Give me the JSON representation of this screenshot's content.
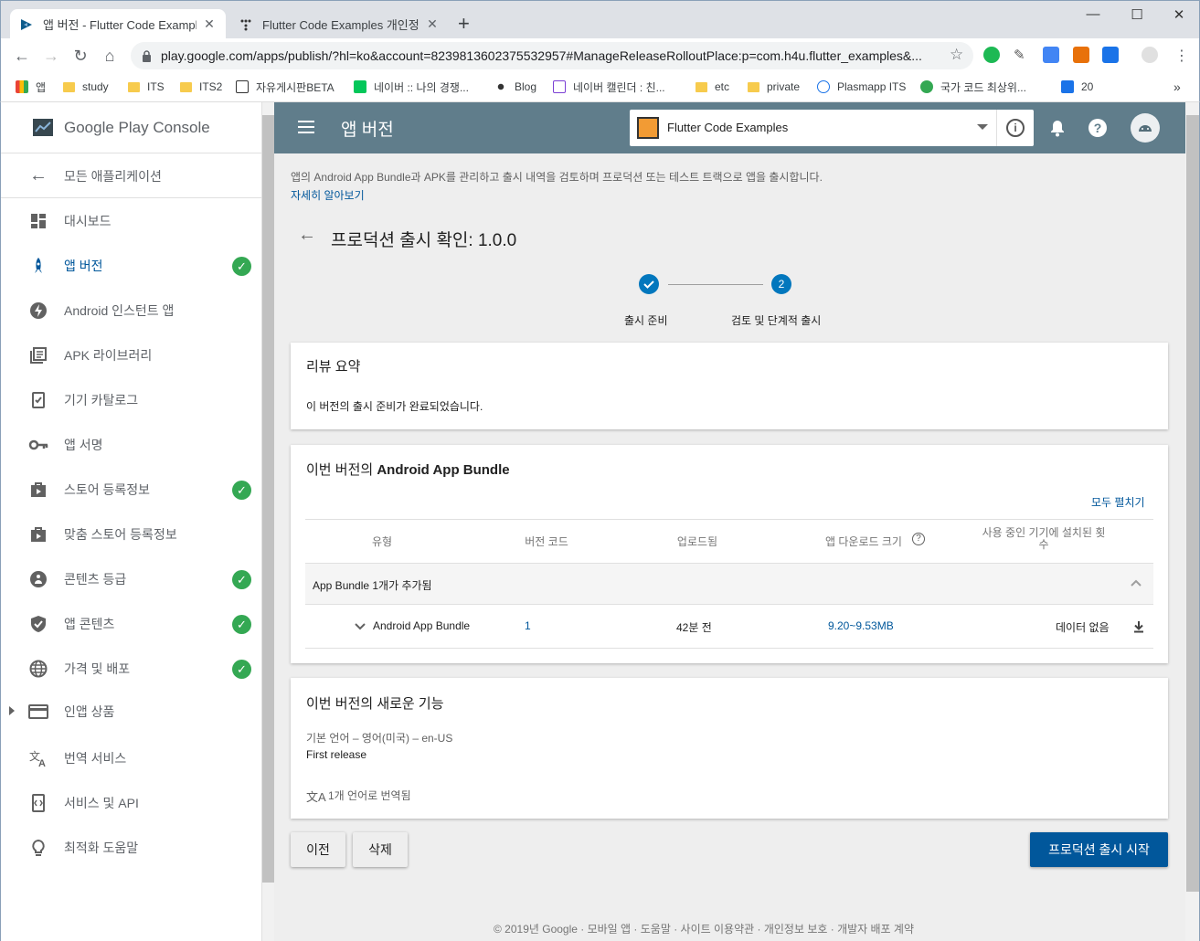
{
  "browser": {
    "tabs": [
      {
        "title": "앱 버전 - Flutter Code Examples",
        "active": true
      },
      {
        "title": "Flutter Code Examples 개인정보",
        "active": false
      }
    ],
    "new_tab": "+",
    "window_controls": {
      "minimize": "—",
      "maximize": "☐",
      "close": "✕"
    },
    "url": "play.google.com/apps/publish/?hl=ko&account=8239813602375532957#ManageReleaseRolloutPlace:p=com.h4u.flutter_examples&...",
    "bookmarks": [
      {
        "label": "앱",
        "icon": "apps-grid-icon"
      },
      {
        "label": "study",
        "icon": "folder-icon"
      },
      {
        "label": "ITS",
        "icon": "folder-icon"
      },
      {
        "label": "ITS2",
        "icon": "folder-icon"
      },
      {
        "label": "자유게시판BETA",
        "icon": "site-icon"
      },
      {
        "label": "네이버 :: 나의 경쟁...",
        "icon": "naver-icon"
      },
      {
        "label": "Blog",
        "icon": "site-icon"
      },
      {
        "label": "네이버 캘린더 : 친...",
        "icon": "calendar-icon"
      },
      {
        "label": "etc",
        "icon": "folder-icon"
      },
      {
        "label": "private",
        "icon": "folder-icon"
      },
      {
        "label": "Plasmapp ITS",
        "icon": "site-icon"
      },
      {
        "label": "국가 코드 최상위...",
        "icon": "site-icon"
      },
      {
        "label": "20",
        "icon": "site-icon"
      }
    ],
    "bookmarks_more": "»"
  },
  "console": {
    "logo_text": "Google Play Console",
    "back_label": "모든 애플리케이션",
    "nav": [
      {
        "label": "대시보드",
        "icon": "dashboard-icon",
        "check": false,
        "active": false
      },
      {
        "label": "앱 버전",
        "icon": "rocket-icon",
        "check": true,
        "active": true
      },
      {
        "label": "Android 인스턴트 앱",
        "icon": "bolt-icon",
        "check": false,
        "active": false
      },
      {
        "label": "APK 라이브러리",
        "icon": "library-icon",
        "check": false,
        "active": false
      },
      {
        "label": "기기 카탈로그",
        "icon": "device-catalog-icon",
        "check": false,
        "active": false
      },
      {
        "label": "앱 서명",
        "icon": "key-icon",
        "check": false,
        "active": false
      },
      {
        "label": "스토어 등록정보",
        "icon": "store-icon",
        "check": true,
        "active": false
      },
      {
        "label": "맞춤 스토어 등록정보",
        "icon": "custom-store-icon",
        "check": false,
        "active": false
      },
      {
        "label": "콘텐츠 등급",
        "icon": "content-rating-icon",
        "check": true,
        "active": false
      },
      {
        "label": "앱 콘텐츠",
        "icon": "shield-icon",
        "check": true,
        "active": false
      },
      {
        "label": "가격 및 배포",
        "icon": "globe-icon",
        "check": true,
        "active": false
      },
      {
        "label": "인앱 상품",
        "icon": "card-icon",
        "check": false,
        "active": false
      },
      {
        "label": "번역 서비스",
        "icon": "translate-icon",
        "check": false,
        "active": false
      },
      {
        "label": "서비스 및 API",
        "icon": "api-icon",
        "check": false,
        "active": false
      },
      {
        "label": "최적화 도움말",
        "icon": "lightbulb-icon",
        "check": false,
        "active": false
      }
    ]
  },
  "appbar": {
    "title": "앱 버전",
    "app_name": "Flutter Code Examples",
    "color": "#607d8b"
  },
  "intro": {
    "description": "앱의 Android App Bundle과 APK를 관리하고 출시 내역을 검토하며 프로덕션 또는 테스트 트랙으로 앱을 출시합니다.",
    "learn_more": "자세히 알아보기"
  },
  "page_title": "프로덕션 출시 확인: 1.0.0",
  "stepper": {
    "step1_label": "출시 준비",
    "step2_number": "2",
    "step2_label": "검토 및 단계적 출시"
  },
  "review": {
    "title": "리뷰 요약",
    "message": "이 버전의 출시 준비가 완료되었습니다."
  },
  "bundle": {
    "title_prefix": "이번 버전의 ",
    "title_bold": "Android App Bundle",
    "expand_all": "모두 펼치기",
    "headers": [
      "유형",
      "버전 코드",
      "업로드됨",
      "앱 다운로드 크기",
      "사용 중인 기기에 설치된 횟수"
    ],
    "group_label": "App Bundle 1개가 추가됨",
    "row": {
      "type": "Android App Bundle",
      "version_code": "1",
      "uploaded": "42분 전",
      "download_size": "9.20~9.53MB",
      "installs": "데이터 없음"
    }
  },
  "whatsnew": {
    "title": "이번 버전의 새로운 기능",
    "language": "기본 언어 – 영어(미국) – en-US",
    "text": "First release",
    "translated": "1개 언어로 번역됨"
  },
  "buttons": {
    "previous": "이전",
    "delete": "삭제",
    "start": "프로덕션 출시 시작"
  },
  "footer": "© 2019년 Google · 모바일 앱 · 도움말 · 사이트 이용약관 · 개인정보 보호 · 개발자 배포 계약",
  "colors": {
    "accent": "#01579b",
    "check": "#34a853",
    "step": "#0277bd"
  }
}
